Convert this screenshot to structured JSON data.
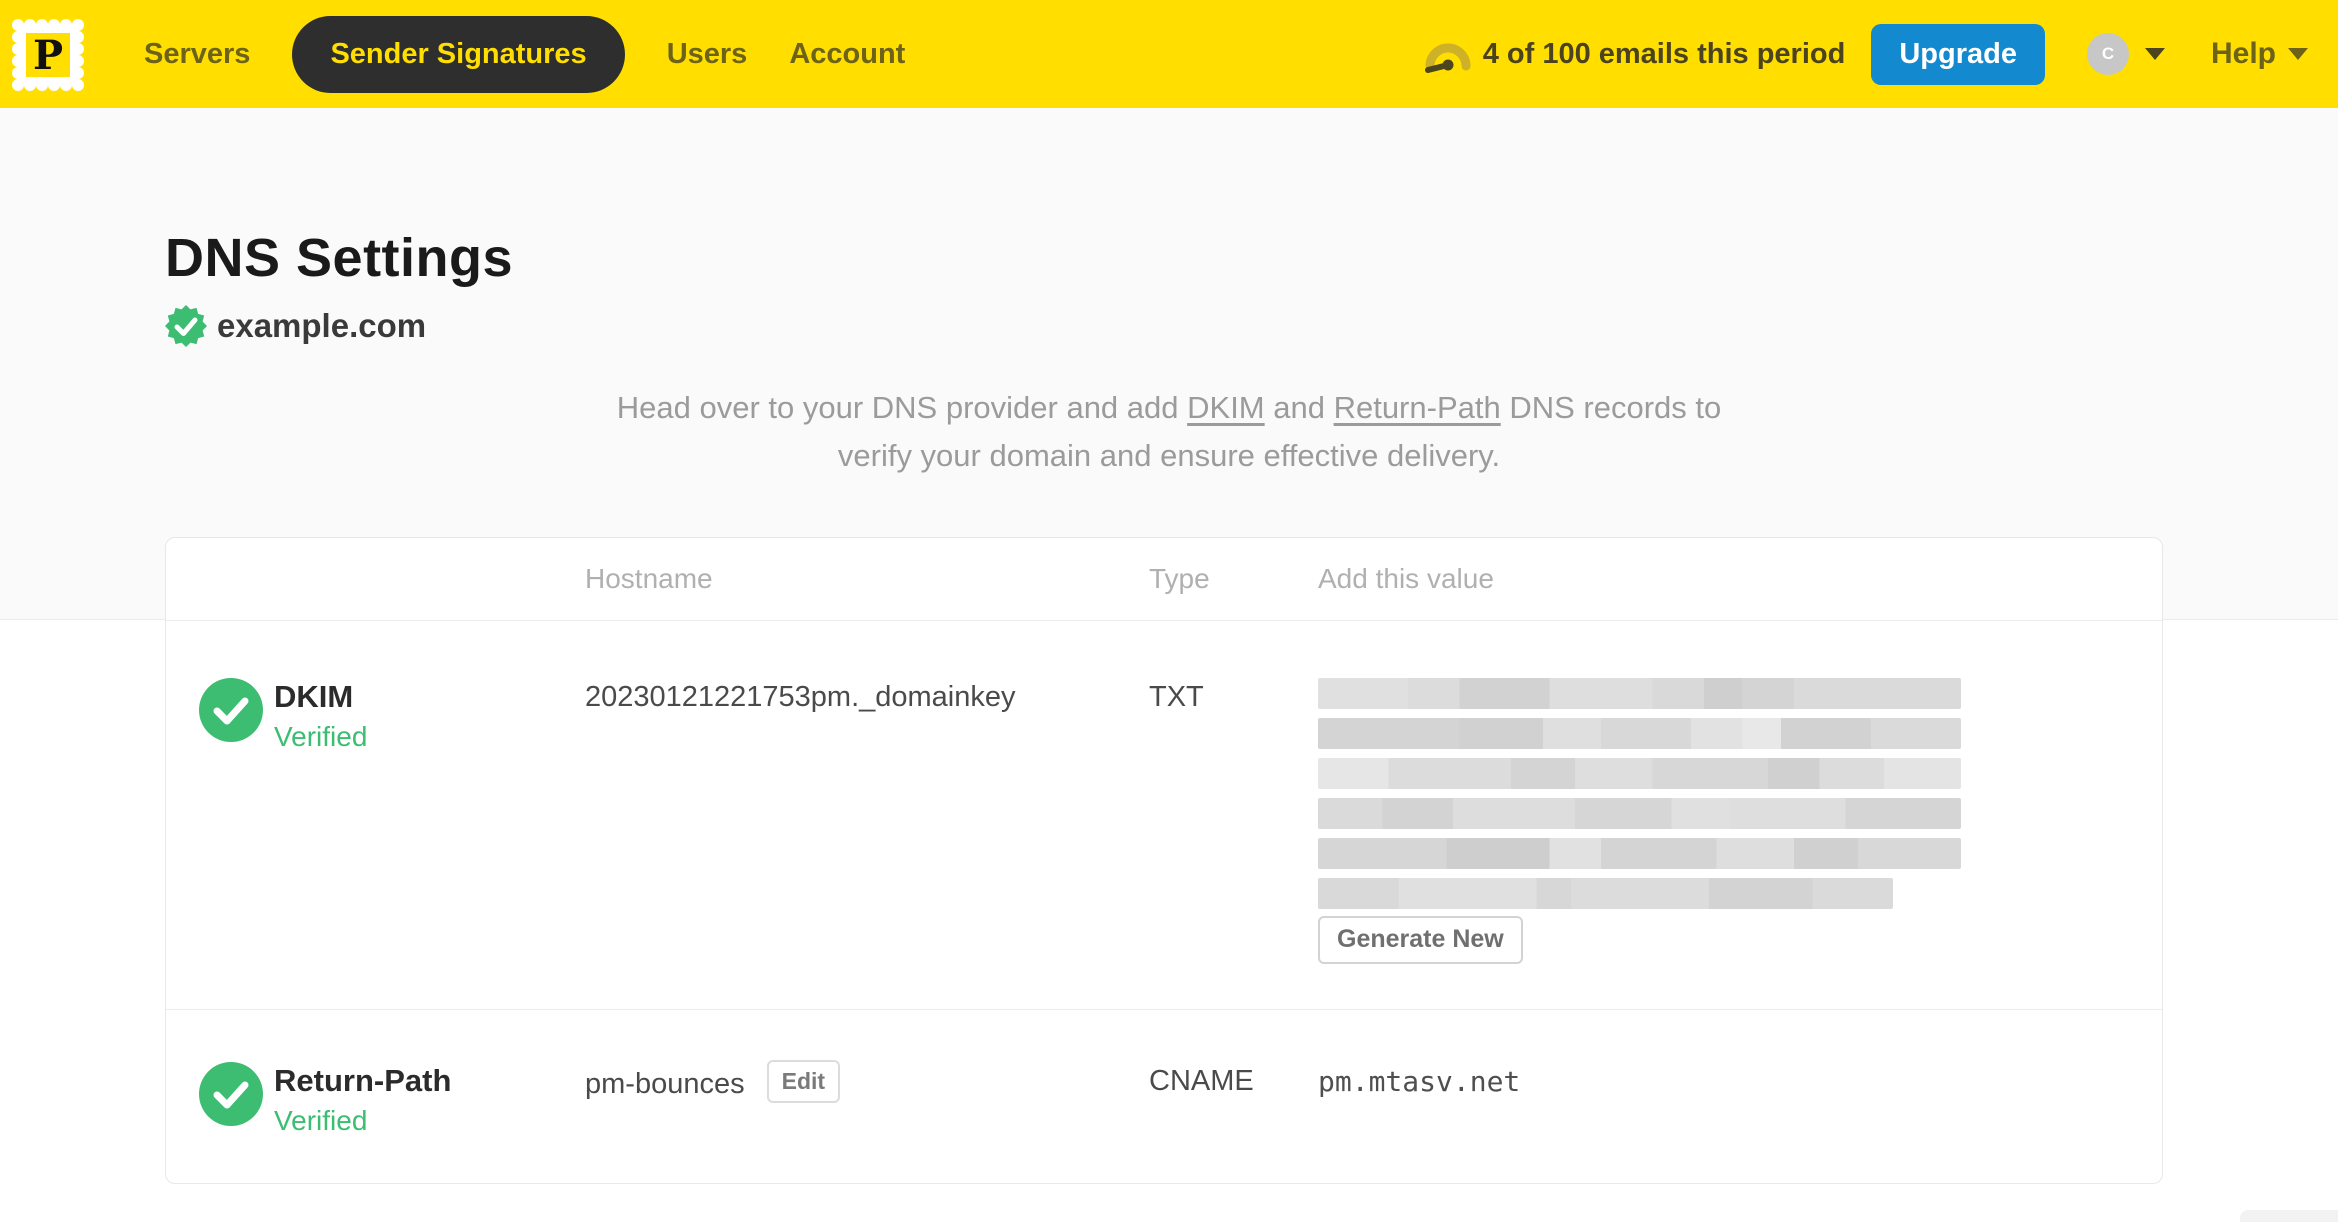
{
  "nav": {
    "logo_letter": "P",
    "items": [
      {
        "label": "Servers",
        "active": false
      },
      {
        "label": "Sender Signatures",
        "active": true
      },
      {
        "label": "Users",
        "active": false
      },
      {
        "label": "Account",
        "active": false
      }
    ],
    "usage": "4 of 100 emails this period",
    "upgrade_label": "Upgrade",
    "avatar_initial": "C",
    "help_label": "Help"
  },
  "page": {
    "title": "DNS Settings",
    "domain": "example.com",
    "domain_verified": true,
    "desc": {
      "line1_pre": "Head over to your DNS provider and add ",
      "link1": "DKIM",
      "mid": " and ",
      "link2": "Return-Path",
      "line1_post": " DNS records to",
      "line2": "verify your domain and ensure effective delivery."
    }
  },
  "table": {
    "headers": {
      "hostname": "Hostname",
      "type": "Type",
      "value": "Add this value"
    },
    "rows": [
      {
        "name": "DKIM",
        "status": "Verified",
        "hostname": "20230121221753pm._domainkey",
        "type": "TXT",
        "value_redacted": true,
        "action_label": "Generate New"
      },
      {
        "name": "Return-Path",
        "status": "Verified",
        "hostname": "pm-bounces",
        "edit_label": "Edit",
        "type": "CNAME",
        "value": "pm.mtasv.net"
      }
    ]
  },
  "colors": {
    "brand_yellow": "#ffde00",
    "nav_active_bg": "#2e2e2e",
    "upgrade_blue": "#1389cf",
    "verified_green": "#3cbd72"
  }
}
